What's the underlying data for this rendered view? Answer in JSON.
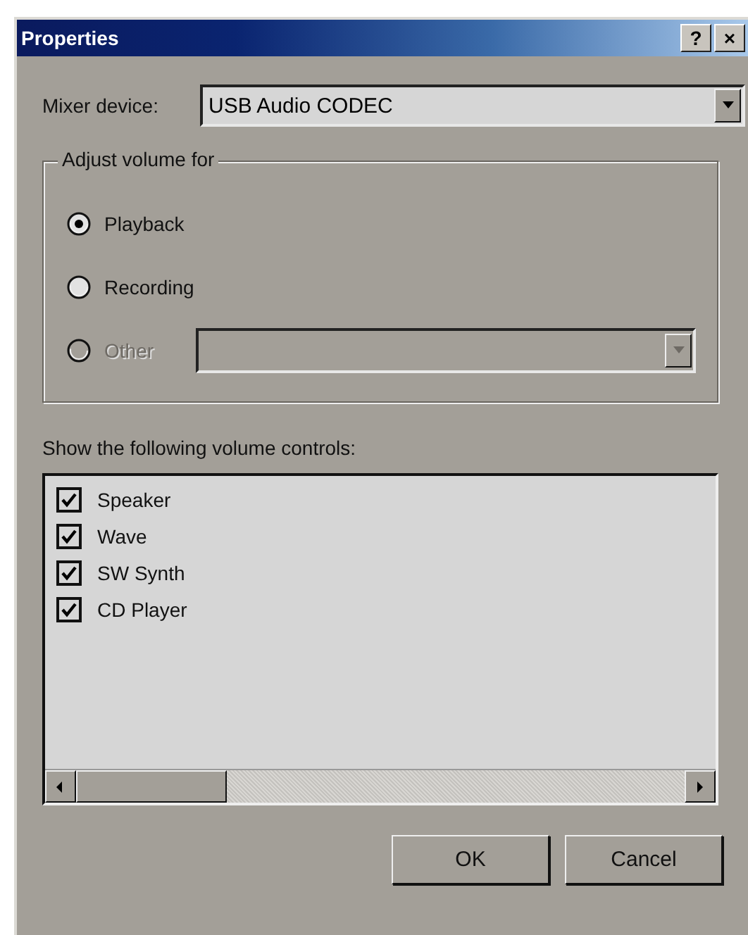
{
  "window": {
    "title": "Properties",
    "buttons": [
      "?",
      "×"
    ]
  },
  "mixer": {
    "label": "Mixer device:",
    "value": "USB Audio CODEC"
  },
  "adjust_group": {
    "title": "Adjust volume for",
    "options": [
      {
        "label": "Playback",
        "selected": true,
        "disabled": false
      },
      {
        "label": "Recording",
        "selected": false,
        "disabled": false
      },
      {
        "label": "Other",
        "selected": false,
        "disabled": true,
        "has_dropdown": true
      }
    ]
  },
  "controls_label": "Show the following volume controls:",
  "controls": [
    {
      "label": "Speaker",
      "checked": true
    },
    {
      "label": "Wave",
      "checked": true
    },
    {
      "label": "SW Synth",
      "checked": true
    },
    {
      "label": "CD Player",
      "checked": true
    }
  ],
  "buttons": [
    "OK",
    "Cancel"
  ]
}
